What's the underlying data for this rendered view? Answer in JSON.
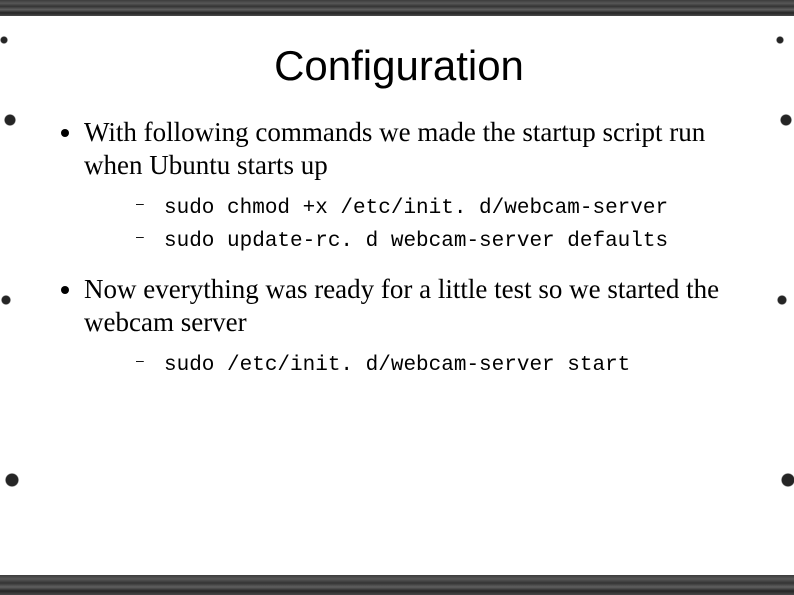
{
  "title": "Configuration",
  "bullets": [
    {
      "text": "With following commands we made the startup script run when Ubuntu starts up",
      "code": [
        "sudo chmod +x /etc/init. d/webcam-server",
        "sudo update-rc. d webcam-server defaults"
      ]
    },
    {
      "text": "Now everything was ready for a little test so we started the webcam server",
      "code": [
        "sudo /etc/init. d/webcam-server start"
      ]
    }
  ]
}
